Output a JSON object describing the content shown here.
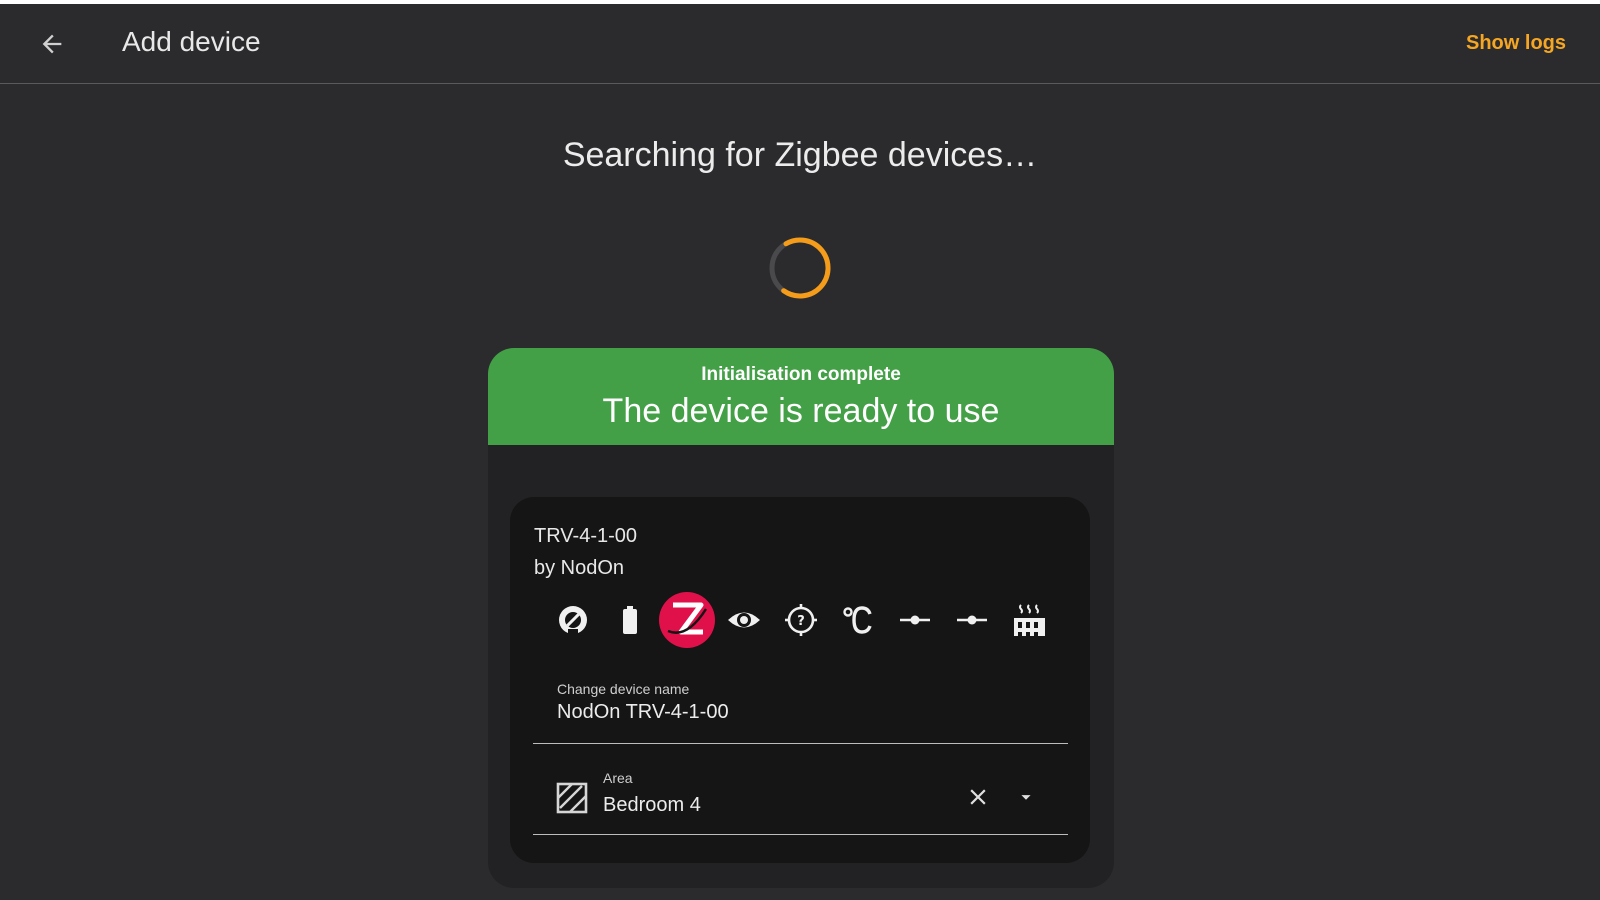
{
  "header": {
    "title": "Add device",
    "show_logs_label": "Show logs"
  },
  "main": {
    "search_title": "Searching for Zigbee devices…"
  },
  "device_card": {
    "banner": {
      "subtitle": "Initialisation complete",
      "title": "The device is ready to use",
      "color": "#43a047"
    },
    "model": "TRV-4-1-00",
    "manufacturer": "by NodOn",
    "entity_icons": [
      "gauge-icon",
      "battery-icon",
      "zigbee-icon",
      "eye-icon",
      "crosshairs-question-icon",
      "temperature-celsius-icon",
      "slider-icon",
      "slider-icon",
      "radiator-icon"
    ],
    "name_field": {
      "label": "Change device name",
      "value": "NodOn TRV-4-1-00"
    },
    "area_field": {
      "label": "Area",
      "value": "Bedroom 4"
    }
  },
  "colors": {
    "accent": "#f5a623",
    "zigbee": "#e0114a",
    "background": "#2b2b2d"
  }
}
